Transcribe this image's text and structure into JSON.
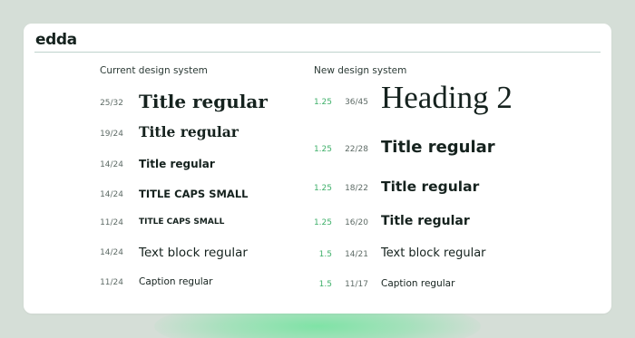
{
  "brand": {
    "logo": "edda"
  },
  "left_column": {
    "title": "Current design system",
    "rows": [
      {
        "line_height": "25/32",
        "label": "Title regular"
      },
      {
        "line_height": "19/24",
        "label": "Title regular"
      },
      {
        "line_height": "14/24",
        "label": "Title regular"
      },
      {
        "line_height": "14/24",
        "label": "TITLE CAPS SMALL"
      },
      {
        "line_height": "11/24",
        "label": "TITLE CAPS SMALL"
      },
      {
        "line_height": "14/24",
        "label": "Text block regular"
      },
      {
        "line_height": "11/24",
        "label": "Caption regular"
      }
    ]
  },
  "right_column": {
    "title": "New design system",
    "rows": [
      {
        "ratio": "1.25",
        "line_height": "36/45",
        "label": "Heading 2"
      },
      {
        "ratio": "1.25",
        "line_height": "22/28",
        "label": "Title regular"
      },
      {
        "ratio": "1.25",
        "line_height": "18/22",
        "label": "Title regular"
      },
      {
        "ratio": "1.25",
        "line_height": "16/20",
        "label": "Title regular"
      },
      {
        "ratio": "1.5",
        "line_height": "14/21",
        "label": "Text block regular"
      },
      {
        "ratio": "1.5",
        "line_height": "11/17",
        "label": "Caption regular"
      }
    ]
  },
  "colors": {
    "background": "#d5ded7",
    "card": "#ffffff",
    "accent_green": "#3fb06a",
    "text": "#15221e"
  }
}
